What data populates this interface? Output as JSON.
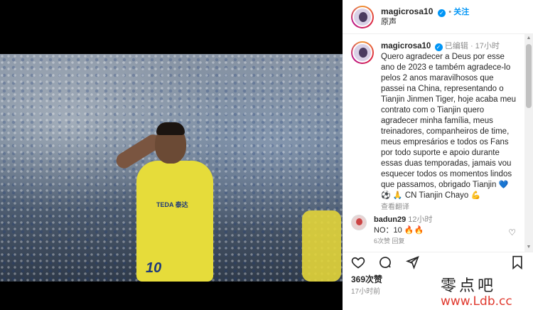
{
  "post": {
    "author": "magicrosa10",
    "follow_label": "关注",
    "audio_label": "原声",
    "edited_label": "已编辑",
    "age": "17小时",
    "caption": "Quero agradecer a Deus por esse ano de 2023 e também agradece-lo pelos 2 anos maravilhosos que passei na China, representando o Tianjin Jinmen Tiger, hoje acaba meu contrato com o Tianjin quero agradecer minha família, meus treinadores, companheiros de time, meus empresários e todos os Fans por todo suporte e apoio durante essas duas temporadas, jamais vou esquecer todos os momentos lindos que passamos, obrigado Tianjin",
    "caption_tail": "CN Tianjin Chayo",
    "see_translation": "查看翻译",
    "jersey_sponsor": "TEDA 泰达",
    "jersey_number": "10"
  },
  "comment": {
    "author": "badun29",
    "age": "12小时",
    "text": "NO：10",
    "meta": "6次赞   回复"
  },
  "footer": {
    "likes": "369次赞",
    "timestamp": "17小时前"
  },
  "watermark": {
    "cn": "零点吧",
    "url": "www.Ldb.cc"
  },
  "icons": [
    "heart-icon",
    "comment-icon",
    "share-icon",
    "bookmark-icon",
    "verified-icon",
    "fire-icon",
    "flex-icon"
  ]
}
